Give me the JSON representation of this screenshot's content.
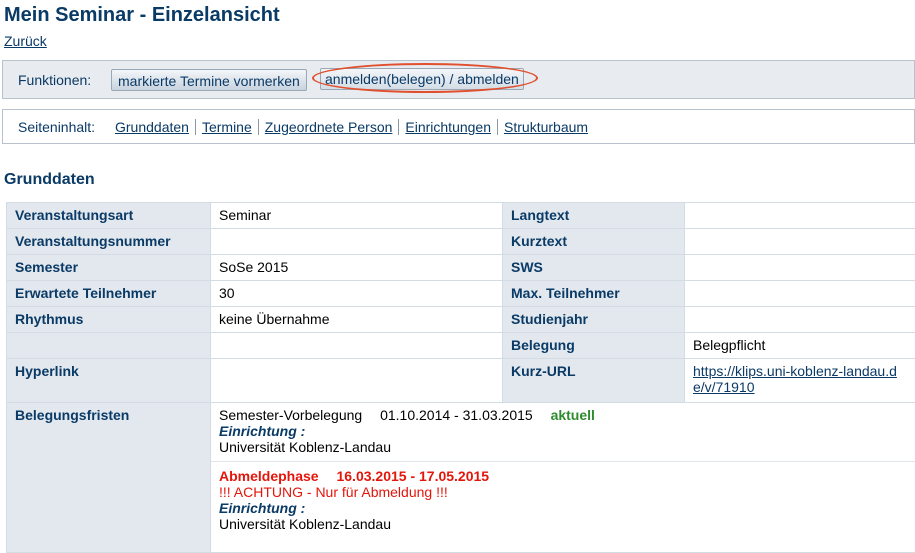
{
  "page": {
    "title": "Mein Seminar - Einzelansicht",
    "back_link": "Zurück"
  },
  "functions": {
    "label": "Funktionen:",
    "mark_button": "markierte Termine vormerken",
    "register_button": "anmelden(belegen) / abmelden"
  },
  "nav": {
    "label": "Seiteninhalt:",
    "links": [
      "Grunddaten",
      "Termine",
      "Zugeordnete Person",
      "Einrichtungen",
      "Strukturbaum"
    ]
  },
  "section_title": "Grunddaten",
  "rows": [
    {
      "k1": "Veranstaltungsart",
      "v1": "Seminar",
      "k2": "Langtext",
      "v2": ""
    },
    {
      "k1": "Veranstaltungsnummer",
      "v1": "",
      "k2": "Kurztext",
      "v2": ""
    },
    {
      "k1": "Semester",
      "v1": "SoSe 2015",
      "k2": "SWS",
      "v2": ""
    },
    {
      "k1": "Erwartete Teilnehmer",
      "v1": "30",
      "k2": "Max. Teilnehmer",
      "v2": ""
    },
    {
      "k1": "Rhythmus",
      "v1": "keine Übernahme",
      "k2": "Studienjahr",
      "v2": ""
    },
    {
      "k1": "",
      "v1": "",
      "k2": "Belegung",
      "v2": "Belegpflicht"
    },
    {
      "k1": "Hyperlink",
      "v1": "",
      "k2": "Kurz-URL",
      "v2": "https://klips.uni-koblenz-landau.de/v/71910"
    }
  ],
  "fristen": {
    "label": "Belegungsfristen",
    "phase1": {
      "name": "Semester-Vorbelegung",
      "dates": "01.10.2014 - 31.03.2015",
      "status": "aktuell",
      "einrichtung_label": "Einrichtung :",
      "einrichtung": "Universität Koblenz-Landau"
    },
    "phase2": {
      "name": "Abmeldephase",
      "dates": "16.03.2015 - 17.05.2015",
      "warning": "!!! ACHTUNG - Nur für Abmeldung !!!",
      "einrichtung_label": "Einrichtung :",
      "einrichtung": "Universität Koblenz-Landau"
    }
  },
  "colors": {
    "primary": "#0a3a66",
    "label_bg": "#e2e8ee",
    "status_green": "#2e8b2e",
    "warning_red": "#e3160b",
    "highlight_oval": "#e0502e"
  }
}
